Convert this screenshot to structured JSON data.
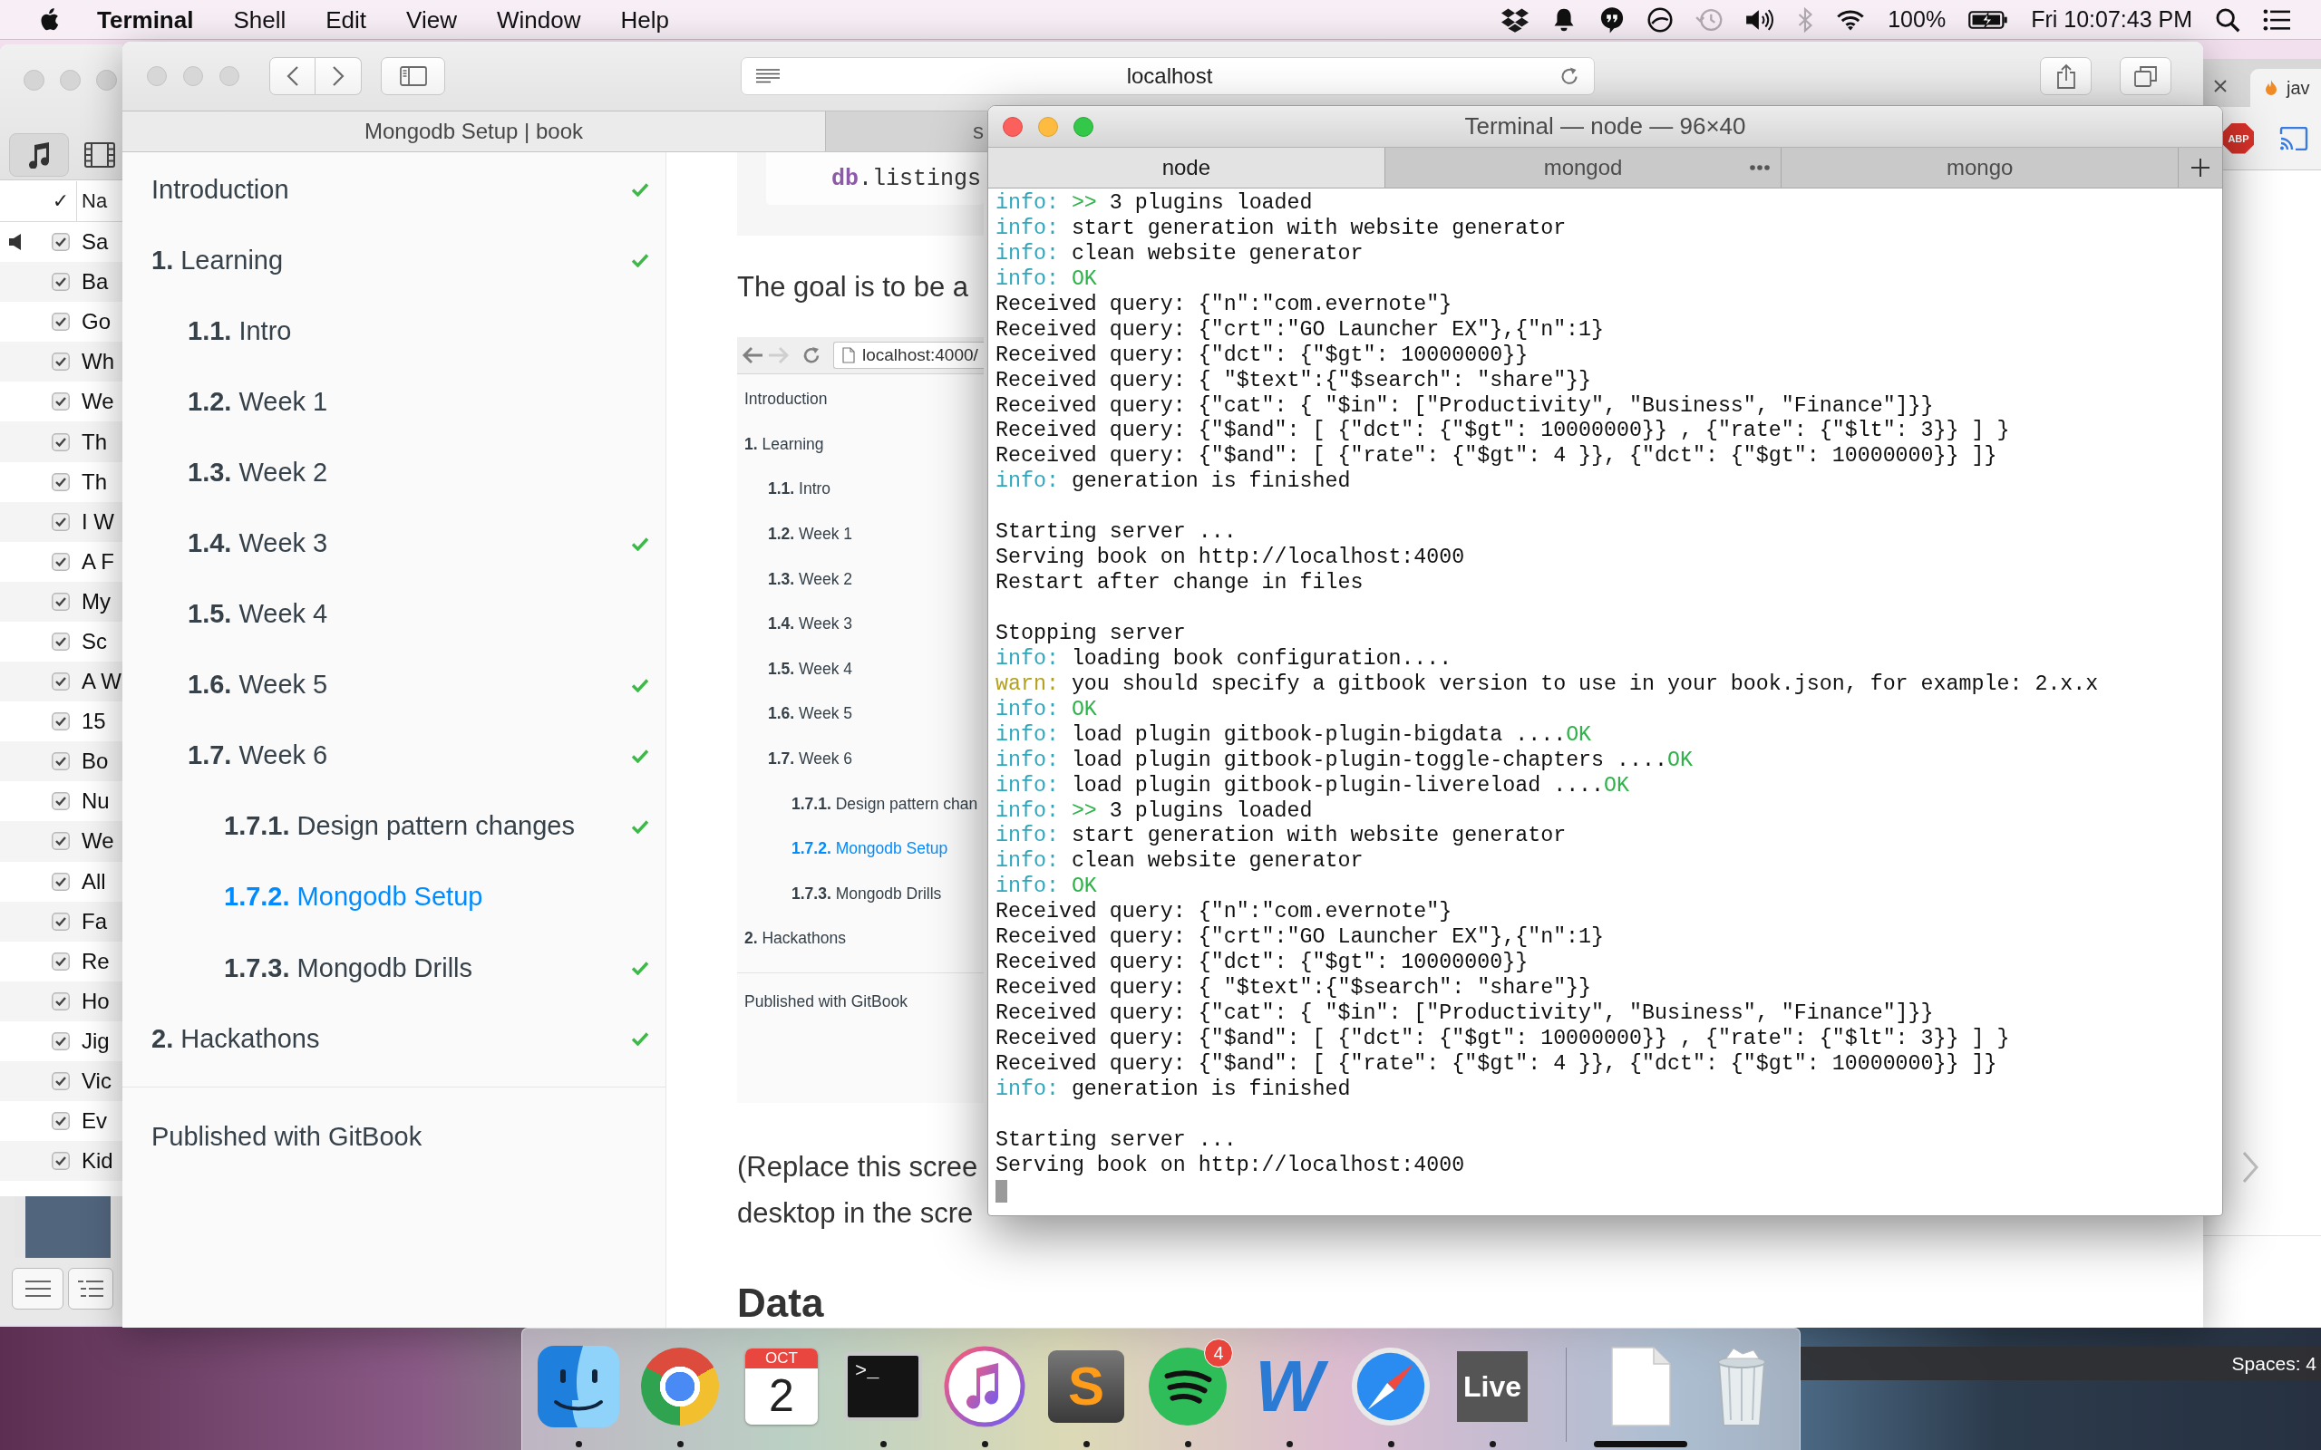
{
  "menu_bar": {
    "app": "Terminal",
    "menus": [
      "Shell",
      "Edit",
      "View",
      "Window",
      "Help"
    ],
    "status": [
      {
        "kind": "dropbox",
        "dimmed": false
      },
      {
        "kind": "bell",
        "dimmed": false
      },
      {
        "kind": "chat",
        "dimmed": false
      },
      {
        "kind": "sync",
        "dimmed": false
      },
      {
        "kind": "backup",
        "dimmed": true
      },
      {
        "kind": "volume",
        "dimmed": false
      },
      {
        "kind": "bluetooth",
        "dimmed": true
      },
      {
        "kind": "wifi",
        "dimmed": false
      }
    ],
    "battery": "100%",
    "clock": "Fri 10:07:43 PM"
  },
  "music_window": {
    "sources": [
      {
        "kind": "music",
        "selected": true
      },
      {
        "kind": "video",
        "selected": false
      }
    ],
    "columns": [
      "✓",
      "Na"
    ],
    "rows": [
      {
        "name": "Sa",
        "checked": true,
        "playing": true
      },
      {
        "name": "Ba",
        "checked": true,
        "playing": false
      },
      {
        "name": "Go",
        "checked": true,
        "playing": false
      },
      {
        "name": "Wh",
        "checked": true,
        "playing": false
      },
      {
        "name": "We",
        "checked": true,
        "playing": false
      },
      {
        "name": "Th",
        "checked": true,
        "playing": false
      },
      {
        "name": "Th",
        "checked": true,
        "playing": false
      },
      {
        "name": "I W",
        "checked": true,
        "playing": false
      },
      {
        "name": "A F",
        "checked": true,
        "playing": false
      },
      {
        "name": "My",
        "checked": true,
        "playing": false
      },
      {
        "name": "Sc",
        "checked": true,
        "playing": false
      },
      {
        "name": "A W",
        "checked": true,
        "playing": false
      },
      {
        "name": "15",
        "checked": true,
        "playing": false
      },
      {
        "name": "Bo",
        "checked": true,
        "playing": false
      },
      {
        "name": "Nu",
        "checked": true,
        "playing": false
      },
      {
        "name": "We",
        "checked": true,
        "playing": false
      },
      {
        "name": "All",
        "checked": true,
        "playing": false
      },
      {
        "name": "Fa",
        "checked": true,
        "playing": false
      },
      {
        "name": "Re",
        "checked": true,
        "playing": false
      },
      {
        "name": "Ho",
        "checked": true,
        "playing": false
      },
      {
        "name": "Jig",
        "checked": true,
        "playing": false
      },
      {
        "name": "Vic",
        "checked": true,
        "playing": false
      },
      {
        "name": "Ev",
        "checked": true,
        "playing": false
      },
      {
        "name": "Kid",
        "checked": true,
        "playing": false
      }
    ]
  },
  "book_browser": {
    "address": "localhost",
    "tabs": [
      {
        "title": "Mongodb Setup | book",
        "selected": true
      },
      {
        "title": "s",
        "selected": false
      }
    ],
    "summary": {
      "items": [
        {
          "label": "Introduction",
          "done": true,
          "selected": false
        },
        {
          "label": "**1.** Learning",
          "done": true,
          "selected": false,
          "children": [
            {
              "label": "**1.1.** Intro",
              "done": false,
              "selected": false
            },
            {
              "label": "**1.2.** Week 1",
              "done": false,
              "selected": false
            },
            {
              "label": "**1.3.** Week 2",
              "done": false,
              "selected": false
            },
            {
              "label": "**1.4.** Week 3",
              "done": true,
              "selected": false
            },
            {
              "label": "**1.5.** Week 4",
              "done": false,
              "selected": false
            },
            {
              "label": "**1.6.** Week 5",
              "done": true,
              "selected": false
            },
            {
              "label": "**1.7.** Week 6",
              "done": true,
              "selected": false,
              "children": [
                {
                  "label": "**1.7.1.** Design pattern changes",
                  "done": true,
                  "selected": false
                },
                {
                  "label": "**1.7.2.** Mongodb Setup",
                  "done": false,
                  "selected": true
                },
                {
                  "label": "**1.7.3.** Mongodb Drills",
                  "done": true,
                  "selected": false
                }
              ]
            }
          ]
        },
        {
          "label": "**2.** Hackathons",
          "done": true,
          "selected": false
        }
      ],
      "footer": "Published with GitBook"
    },
    "page": {
      "code": [
        {
          "kind": "keyword",
          "text": "db"
        },
        {
          "kind": "plain",
          "text": ".listings"
        }
      ],
      "lead": "The goal is to be a",
      "screenshot": {
        "address": "localhost:4000/",
        "items": [
          {
            "label": "Introduction",
            "selected": false
          },
          {
            "label": "**1.** Learning",
            "selected": false,
            "children": [
              {
                "label": "**1.1.** Intro",
                "selected": false
              },
              {
                "label": "**1.2.** Week 1",
                "selected": false
              },
              {
                "label": "**1.3.** Week 2",
                "selected": false
              },
              {
                "label": "**1.4.** Week 3",
                "selected": false
              },
              {
                "label": "**1.5.** Week 4",
                "selected": false
              },
              {
                "label": "**1.6.** Week 5",
                "selected": false
              },
              {
                "label": "**1.7.** Week 6",
                "selected": false,
                "children": [
                  {
                    "label": "**1.7.1.** Design pattern chan",
                    "selected": false
                  },
                  {
                    "label": "**1.7.2.** Mongodb Setup",
                    "selected": true
                  },
                  {
                    "label": "**1.7.3.** Mongodb Drills",
                    "selected": false
                  }
                ]
              }
            ]
          },
          {
            "label": "**2.** Hackathons",
            "selected": false
          }
        ],
        "footer": "Published with GitBook"
      },
      "note_lines": [
        "(Replace this scree",
        "desktop in the scre"
      ],
      "heading": "Data"
    }
  },
  "terminal": {
    "title": "Terminal — node — 96×40",
    "tabs": [
      {
        "title": "node",
        "selected": true,
        "busy": false
      },
      {
        "title": "mongod",
        "selected": false,
        "busy": true
      },
      {
        "title": "mongo",
        "selected": false,
        "busy": false
      }
    ],
    "blocks": [
      [
        [
          {
            "kind": "info",
            "text": "info: "
          },
          {
            "kind": "ok",
            "text": ">> "
          },
          {
            "kind": "plain",
            "text": "3 plugins loaded"
          }
        ],
        [
          {
            "kind": "info",
            "text": "info: "
          },
          {
            "kind": "plain",
            "text": "start generation with website generator"
          }
        ],
        [
          {
            "kind": "info",
            "text": "info: "
          },
          {
            "kind": "plain",
            "text": "clean website generator"
          }
        ],
        [
          {
            "kind": "info",
            "text": "info: "
          },
          {
            "kind": "ok",
            "text": "OK"
          }
        ],
        [
          {
            "kind": "plain",
            "text": "Received query: {\"n\":\"com.evernote\"}"
          }
        ],
        [
          {
            "kind": "plain",
            "text": "Received query: {\"crt\":\"GO Launcher EX\"},{\"n\":1}"
          }
        ],
        [
          {
            "kind": "plain",
            "text": "Received query: {\"dct\": {\"$gt\": 10000000}}"
          }
        ],
        [
          {
            "kind": "plain",
            "text": "Received query: { \"$text\":{\"$search\": \"share\"}}"
          }
        ],
        [
          {
            "kind": "plain",
            "text": "Received query: {\"cat\": { \"$in\": [\"Productivity\", \"Business\", \"Finance\"]}}"
          }
        ],
        [
          {
            "kind": "plain",
            "text": "Received query: {\"$and\": [ {\"dct\": {\"$gt\": 10000000}} , {\"rate\": {\"$lt\": 3}} ] }"
          }
        ],
        [
          {
            "kind": "plain",
            "text": "Received query: {\"$and\": [ {\"rate\": {\"$gt\": 4 }}, {\"dct\": {\"$gt\": 10000000}} ]}"
          }
        ],
        [
          {
            "kind": "info",
            "text": "info: "
          },
          {
            "kind": "plain",
            "text": "generation is finished"
          }
        ]
      ],
      [
        [
          {
            "kind": "plain",
            "text": "Starting server ..."
          }
        ],
        [
          {
            "kind": "plain",
            "text": "Serving book on http://localhost:4000"
          }
        ],
        [
          {
            "kind": "plain",
            "text": "Restart after change in files"
          }
        ]
      ],
      [
        [
          {
            "kind": "plain",
            "text": "Stopping server"
          }
        ],
        [
          {
            "kind": "info",
            "text": "info: "
          },
          {
            "kind": "plain",
            "text": "loading book configuration...."
          }
        ],
        [
          {
            "kind": "warn",
            "text": "warn: "
          },
          {
            "kind": "plain",
            "text": "you should specify a gitbook version to use in your book.json, for example: 2.x.x"
          }
        ],
        [
          {
            "kind": "info",
            "text": "info: "
          },
          {
            "kind": "ok",
            "text": "OK"
          }
        ],
        [
          {
            "kind": "info",
            "text": "info: "
          },
          {
            "kind": "plain",
            "text": "load plugin gitbook-plugin-bigdata ...."
          },
          {
            "kind": "ok",
            "text": "OK"
          }
        ],
        [
          {
            "kind": "info",
            "text": "info: "
          },
          {
            "kind": "plain",
            "text": "load plugin gitbook-plugin-toggle-chapters ...."
          },
          {
            "kind": "ok",
            "text": "OK"
          }
        ],
        [
          {
            "kind": "info",
            "text": "info: "
          },
          {
            "kind": "plain",
            "text": "load plugin gitbook-plugin-livereload ...."
          },
          {
            "kind": "ok",
            "text": "OK"
          }
        ],
        [
          {
            "kind": "info",
            "text": "info: "
          },
          {
            "kind": "ok",
            "text": ">> "
          },
          {
            "kind": "plain",
            "text": "3 plugins loaded"
          }
        ],
        [
          {
            "kind": "info",
            "text": "info: "
          },
          {
            "kind": "plain",
            "text": "start generation with website generator"
          }
        ],
        [
          {
            "kind": "info",
            "text": "info: "
          },
          {
            "kind": "plain",
            "text": "clean website generator"
          }
        ],
        [
          {
            "kind": "info",
            "text": "info: "
          },
          {
            "kind": "ok",
            "text": "OK"
          }
        ],
        [
          {
            "kind": "plain",
            "text": "Received query: {\"n\":\"com.evernote\"}"
          }
        ],
        [
          {
            "kind": "plain",
            "text": "Received query: {\"crt\":\"GO Launcher EX\"},{\"n\":1}"
          }
        ],
        [
          {
            "kind": "plain",
            "text": "Received query: {\"dct\": {\"$gt\": 10000000}}"
          }
        ],
        [
          {
            "kind": "plain",
            "text": "Received query: { \"$text\":{\"$search\": \"share\"}}"
          }
        ],
        [
          {
            "kind": "plain",
            "text": "Received query: {\"cat\": { \"$in\": [\"Productivity\", \"Business\", \"Finance\"]}}"
          }
        ],
        [
          {
            "kind": "plain",
            "text": "Received query: {\"$and\": [ {\"dct\": {\"$gt\": 10000000}} , {\"rate\": {\"$lt\": 3}} ] }"
          }
        ],
        [
          {
            "kind": "plain",
            "text": "Received query: {\"$and\": [ {\"rate\": {\"$gt\": 4 }}, {\"dct\": {\"$gt\": 10000000}} ]}"
          }
        ],
        [
          {
            "kind": "info",
            "text": "info: "
          },
          {
            "kind": "plain",
            "text": "generation is finished"
          }
        ]
      ],
      [
        [
          {
            "kind": "plain",
            "text": "Starting server ..."
          }
        ],
        [
          {
            "kind": "plain",
            "text": "Serving book on http://localhost:4000"
          }
        ]
      ]
    ]
  },
  "side_browser": {
    "tab": "jav",
    "badge": "ABP"
  },
  "dock": {
    "apps": [
      {
        "kind": "finder",
        "running": true
      },
      {
        "kind": "browser",
        "running": true
      },
      {
        "kind": "calendar",
        "month": "OCT",
        "day": "2",
        "running": false
      },
      {
        "kind": "terminal",
        "label": ">_",
        "running": true
      },
      {
        "kind": "music",
        "running": true
      },
      {
        "kind": "editor",
        "label": "S",
        "running": true
      },
      {
        "kind": "streaming",
        "badge": "4",
        "running": true
      },
      {
        "kind": "writer",
        "label": "W",
        "running": true
      },
      {
        "kind": "compass",
        "running": true
      },
      {
        "kind": "live",
        "label": "Live",
        "running": true
      }
    ],
    "stacks": [
      {
        "kind": "document",
        "selected": true
      },
      {
        "kind": "trash",
        "selected": false
      }
    ]
  },
  "spaces": "Spaces: 4"
}
